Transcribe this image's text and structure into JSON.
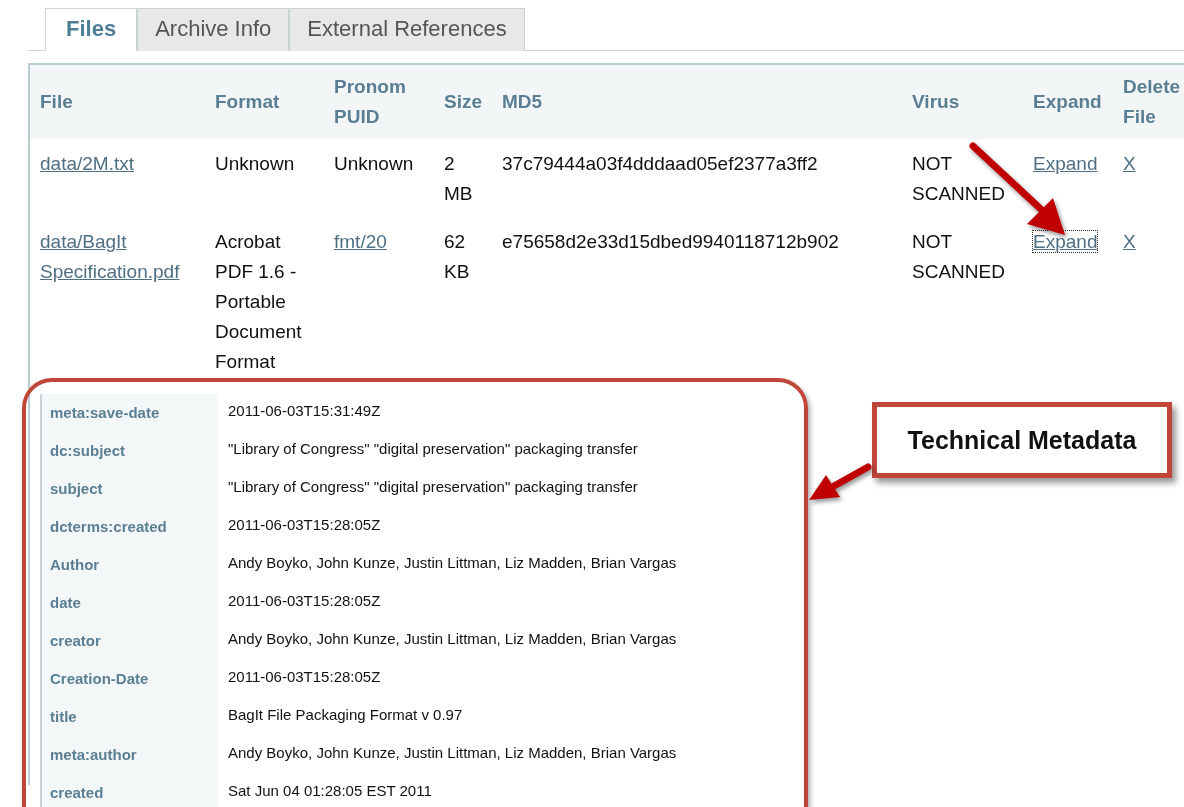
{
  "tabs": [
    {
      "label": "Files",
      "selected": true
    },
    {
      "label": "Archive Info",
      "selected": false
    },
    {
      "label": "External References",
      "selected": false
    }
  ],
  "table": {
    "columns": [
      "File",
      "Format",
      "Pronom PUID",
      "Size",
      "MD5",
      "Virus",
      "Expand",
      "Delete File"
    ],
    "rows": [
      {
        "file": "data/2M.txt",
        "format": "Unknown",
        "puid": {
          "text": "Unknown",
          "kind": "text"
        },
        "size": "2 MB",
        "md5": "37c79444a03f4dddaad05ef2377a3ff2",
        "virus": "NOT SCANNED",
        "expand": {
          "text": "Expand",
          "focused": false
        },
        "delete": "X"
      },
      {
        "file": "data/BagIt Specification.pdf",
        "format": "Acrobat PDF 1.6 - Portable Document Format",
        "puid": {
          "text": "fmt/20",
          "kind": "link"
        },
        "size": "62 KB",
        "md5": "e75658d2e33d15dbed9940118712b902",
        "virus": "NOT SCANNED",
        "expand": {
          "text": "Expand",
          "focused": true
        },
        "delete": "X"
      }
    ]
  },
  "metadata": [
    {
      "key": "meta:save-date",
      "value": "2011-06-03T15:31:49Z"
    },
    {
      "key": "dc:subject",
      "value": "\"Library of Congress\" \"digital preservation\" packaging transfer"
    },
    {
      "key": "subject",
      "value": "\"Library of Congress\" \"digital preservation\" packaging transfer"
    },
    {
      "key": "dcterms:created",
      "value": "2011-06-03T15:28:05Z"
    },
    {
      "key": "Author",
      "value": "Andy Boyko, John Kunze, Justin Littman, Liz Madden, Brian Vargas"
    },
    {
      "key": "date",
      "value": "2011-06-03T15:28:05Z"
    },
    {
      "key": "creator",
      "value": "Andy Boyko, John Kunze, Justin Littman, Liz Madden, Brian Vargas"
    },
    {
      "key": "Creation-Date",
      "value": "2011-06-03T15:28:05Z"
    },
    {
      "key": "title",
      "value": "BagIt File Packaging Format v 0.97"
    },
    {
      "key": "meta:author",
      "value": "Andy Boyko, John Kunze, Justin Littman, Liz Madden, Brian Vargas"
    },
    {
      "key": "created",
      "value": "Sat Jun 04 01:28:05 EST 2011"
    }
  ],
  "callout": {
    "text": "Technical Metadata"
  }
}
